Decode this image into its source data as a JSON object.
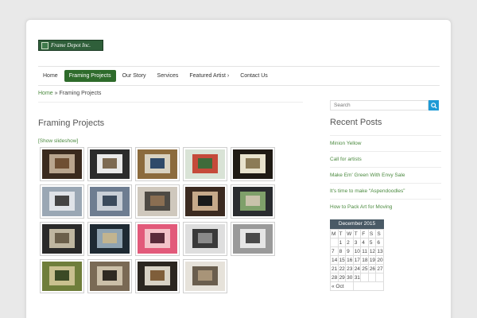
{
  "site": {
    "logo_text": "Frame Depot Inc."
  },
  "nav": {
    "items": [
      {
        "label": "Home",
        "active": false
      },
      {
        "label": "Framing Projects",
        "active": true
      },
      {
        "label": "Our Story",
        "active": false
      },
      {
        "label": "Services",
        "active": false
      },
      {
        "label": "Featured Artist ›",
        "active": false
      },
      {
        "label": "Contact Us",
        "active": false
      }
    ]
  },
  "breadcrumb": {
    "home": "Home",
    "separator": " » ",
    "current": "Framing Projects"
  },
  "page": {
    "title": "Framing Projects",
    "slideshow_link": "[Show slideshow]"
  },
  "gallery": {
    "thumbs": [
      {
        "colors": [
          "#3a2a1e",
          "#b9a58e",
          "#6f4f33"
        ]
      },
      {
        "colors": [
          "#2b2b2b",
          "#e9e9e9",
          "#7d6a52"
        ]
      },
      {
        "colors": [
          "#8c6b3d",
          "#d9d2c1",
          "#2f4a6a"
        ]
      },
      {
        "colors": [
          "#d9e3d6",
          "#c54a3a",
          "#3e6b3a"
        ]
      },
      {
        "colors": [
          "#1f1a14",
          "#e8e2cd",
          "#8b7b57"
        ]
      },
      {
        "colors": [
          "#9aa7b4",
          "#dfe3e8",
          "#444"
        ]
      },
      {
        "colors": [
          "#6e7d91",
          "#c9cfd7",
          "#3b4a5c"
        ]
      },
      {
        "colors": [
          "#cfc8bd",
          "#4e4a44",
          "#8a6e52"
        ]
      },
      {
        "colors": [
          "#3b2a20",
          "#c6a98a",
          "#1a1a1a"
        ]
      },
      {
        "colors": [
          "#2a2c2f",
          "#7fa06a",
          "#c9c2aa"
        ]
      },
      {
        "colors": [
          "#2a2a2a",
          "#bfb6a0",
          "#6b5f4a"
        ]
      },
      {
        "colors": [
          "#1e2a33",
          "#8fa3b1",
          "#c2b48f"
        ]
      },
      {
        "colors": [
          "#e25a7a",
          "#f3c3c9",
          "#5a2b3a"
        ]
      },
      {
        "colors": [
          "#dedede",
          "#3a3a3a",
          "#8a8a8a"
        ]
      },
      {
        "colors": [
          "#9a9a9a",
          "#e6e6e6",
          "#4a4a4a"
        ]
      },
      {
        "colors": [
          "#6f7e3b",
          "#c9c08f",
          "#3b4a25"
        ]
      },
      {
        "colors": [
          "#7a6a55",
          "#cbbfa8",
          "#2f2a22"
        ]
      },
      {
        "colors": [
          "#2b2620",
          "#d8d2c5",
          "#7f5e3a"
        ]
      },
      {
        "colors": [
          "#e6e2da",
          "#6a5e4e",
          "#a89478"
        ]
      }
    ]
  },
  "sidebar": {
    "search_placeholder": "Search",
    "recent_title": "Recent Posts",
    "recent_posts": [
      "Minion Yellow",
      "Call for artists",
      "Make Em' Green With Envy Sale",
      "It's time to make “Aspendoodles”",
      "How to Pack Art for Moving"
    ],
    "calendar": {
      "caption": "December 2015",
      "days": [
        "M",
        "T",
        "W",
        "T",
        "F",
        "S",
        "S"
      ],
      "weeks": [
        [
          "",
          "1",
          "2",
          "3",
          "4",
          "5",
          "6"
        ],
        [
          "7",
          "8",
          "9",
          "10",
          "11",
          "12",
          "13"
        ],
        [
          "14",
          "15",
          "16",
          "17",
          "18",
          "19",
          "20"
        ],
        [
          "21",
          "22",
          "23",
          "24",
          "25",
          "26",
          "27"
        ],
        [
          "28",
          "29",
          "30",
          "31",
          "",
          "",
          ""
        ]
      ],
      "prev": "« Oct"
    }
  },
  "colors": {
    "accent": "#2e6b2b",
    "link": "#4b8a3f",
    "search_button": "#1e9ad6"
  },
  "icons": {
    "search": "search-icon"
  }
}
